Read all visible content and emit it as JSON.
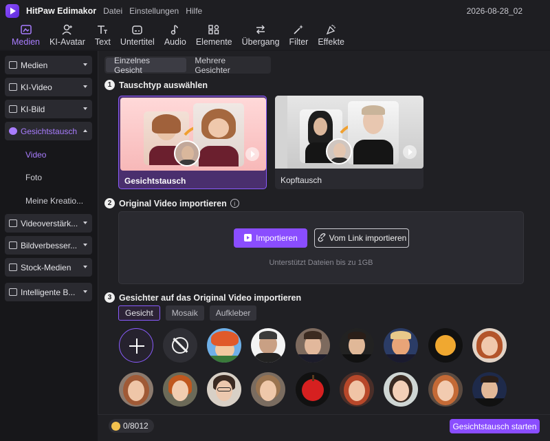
{
  "app": {
    "name": "HitPaw Edimakor",
    "menu": [
      "Datei",
      "Einstellungen",
      "Hilfe"
    ],
    "project_title": "2026-08-28_02"
  },
  "toolbar": [
    {
      "label": "Medien",
      "icon": "media-icon",
      "active": true
    },
    {
      "label": "KI-Avatar",
      "icon": "avatar-icon",
      "active": false
    },
    {
      "label": "Text",
      "icon": "text-icon",
      "active": false
    },
    {
      "label": "Untertitel",
      "icon": "subtitle-icon",
      "active": false
    },
    {
      "label": "Audio",
      "icon": "audio-icon",
      "active": false
    },
    {
      "label": "Elemente",
      "icon": "elements-icon",
      "active": false
    },
    {
      "label": "Übergang",
      "icon": "transition-icon",
      "active": false
    },
    {
      "label": "Filter",
      "icon": "filter-icon",
      "active": false
    },
    {
      "label": "Effekte",
      "icon": "effects-icon",
      "active": false
    }
  ],
  "sidebar": {
    "items": [
      {
        "label": "Medien"
      },
      {
        "label": "KI-Video"
      },
      {
        "label": "KI-Bild"
      },
      {
        "label": "Gesichtstausch"
      },
      {
        "label": "Videoverstärk..."
      },
      {
        "label": "Bildverbesser..."
      },
      {
        "label": "Stock-Medien"
      },
      {
        "label": "Intelligente B..."
      }
    ],
    "subitems": [
      {
        "label": "Video"
      },
      {
        "label": "Foto"
      },
      {
        "label": "Meine Kreatio..."
      }
    ]
  },
  "mode_tabs": [
    "Einzelnes Gesicht",
    "Mehrere Gesichter"
  ],
  "steps": {
    "step1": {
      "num": "1",
      "title": "Tauschtyp auswählen"
    },
    "step2": {
      "num": "2",
      "title": "Original Video importieren",
      "info": "i"
    },
    "step3": {
      "num": "3",
      "title": "Gesichter auf das Original Video importieren"
    }
  },
  "swap_types": [
    {
      "label": "Gesichtstausch",
      "selected": true
    },
    {
      "label": "Kopftausch",
      "selected": false
    }
  ],
  "import": {
    "primary_label": "Importieren",
    "link_label": "Vom Link importieren",
    "hint": "Unterstützt Dateien bis zu 1GB"
  },
  "face_tabs": [
    "Gesicht",
    "Mosaik",
    "Aufkleber"
  ],
  "footer": {
    "credits": "0/8012",
    "start_label": "Gesichtstausch starten"
  },
  "colors": {
    "accent": "#8a4dff",
    "accent_text": "#a97dff",
    "background": "#1b1b1f"
  }
}
